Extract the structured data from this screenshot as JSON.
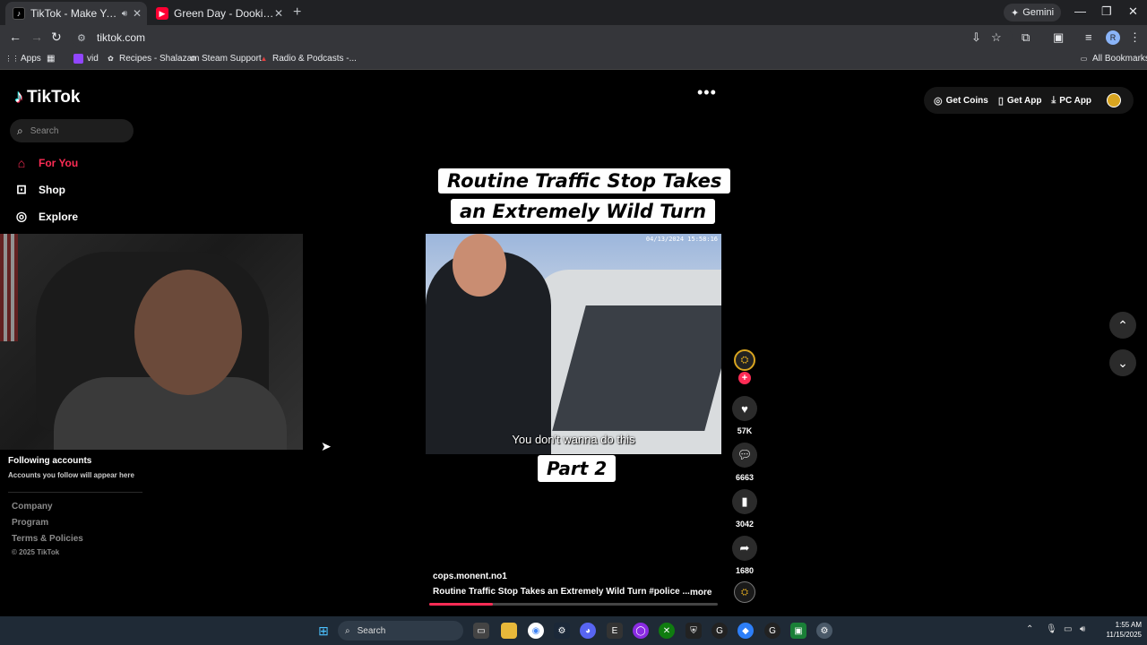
{
  "browser": {
    "tabs": [
      {
        "title": "TikTok - Make Your Day",
        "active": true
      },
      {
        "title": "Green Day - Dookie [Full Album]",
        "active": false
      }
    ],
    "gemini_label": "Gemini",
    "url": "tiktok.com",
    "profile_initial": "R",
    "bookmarks": [
      "Apps",
      "vid",
      "Recipes - Shalazam",
      "Steam Support",
      "Radio & Podcasts -..."
    ],
    "all_bookmarks": "All Bookmarks"
  },
  "sidebar": {
    "logo_text": "TikTok",
    "search_placeholder": "Search",
    "nav": [
      {
        "label": "For You",
        "icon": "home-icon",
        "active": true
      },
      {
        "label": "Shop",
        "icon": "shop-icon"
      },
      {
        "label": "Explore",
        "icon": "compass-icon"
      }
    ],
    "following_title": "Following accounts",
    "following_sub": "Accounts you follow will appear here",
    "footer_links": [
      "Company",
      "Program",
      "Terms & Policies"
    ],
    "copyright": "© 2025 TikTok"
  },
  "header": {
    "buttons": [
      "Get Coins",
      "Get App",
      "PC App"
    ]
  },
  "video": {
    "title_line1": "Routine Traffic Stop Takes",
    "title_line2": "an Extremely Wild Turn",
    "timestamp": "04/13/2024 15:58:16",
    "subtitle": "You don't wanna do this",
    "part_label": "Part 2",
    "author": "cops.monent.no1",
    "description": "Routine Traffic Stop Takes an Extremely Wild Turn #police ...",
    "more_label": "more",
    "progress": 0.22
  },
  "actions": {
    "likes": "57K",
    "comments": "6663",
    "saves": "3042",
    "shares": "1680"
  },
  "taskbar": {
    "search_label": "Search",
    "time": "1:55 AM",
    "date": "11/15/2025"
  }
}
